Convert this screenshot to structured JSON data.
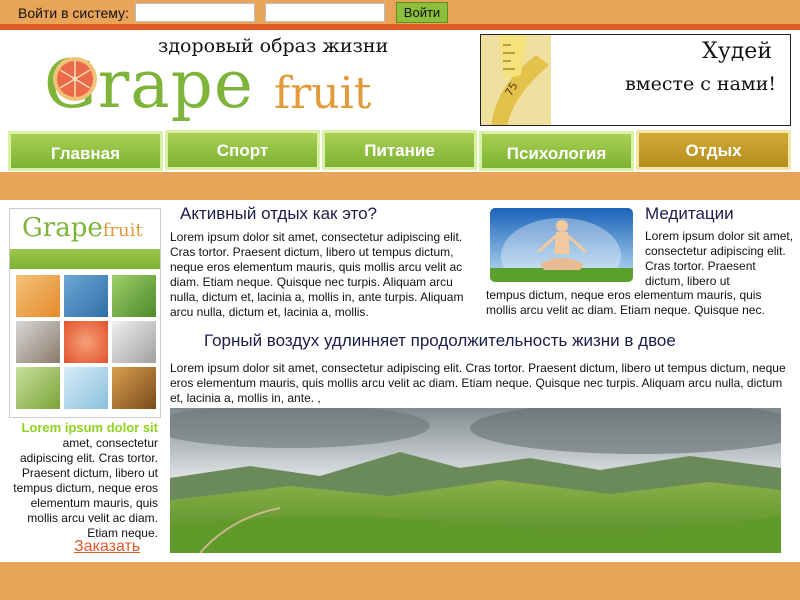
{
  "login": {
    "label": "Войти в систему:",
    "username_value": "",
    "password_value": "",
    "button_label": "Войти"
  },
  "header": {
    "tagline": "здоровый образ жизни",
    "logo_main": "Grape",
    "logo_suffix": "fruit",
    "banner_title": "Худей",
    "banner_subtitle": "вместе с нами!"
  },
  "nav": {
    "items": [
      {
        "label": "Главная"
      },
      {
        "label": "Спорт"
      },
      {
        "label": "Питание"
      },
      {
        "label": "Психология"
      },
      {
        "label": "Отдых",
        "active": true
      }
    ]
  },
  "sidebar": {
    "promo_logo_main": "Grape",
    "promo_logo_suffix": "fruit",
    "highlight": "Lorem ipsum dolor sit",
    "text": "amet, consectetur adipiscing elit. Cras tortor. Praesent dictum, libero ut tempus dictum, neque eros elementum mauris, quis mollis arcu velit ac diam. Etiam neque.",
    "order_link": "Заказать"
  },
  "articles": {
    "active_rest": {
      "title": "Активный отдых как это?",
      "body": "Lorem ipsum dolor sit amet, consectetur adipiscing elit. Cras tortor. Praesent dictum, libero ut tempus dictum, neque eros elementum mauris, quis mollis arcu velit ac diam. Etiam neque. Quisque nec turpis. Aliquam arcu nulla, dictum et, lacinia a, mollis in, ante turpis. Aliquam arcu nulla, dictum et, lacinia a, mollis."
    },
    "meditation": {
      "title": "Медитации",
      "body_top": "Lorem ipsum dolor sit amet, consectetur adipiscing elit. Cras tortor. Praesent dictum, libero ut",
      "body_bottom": "tempus dictum, neque eros elementum mauris, quis mollis arcu velit ac diam. Etiam neque. Quisque nec."
    },
    "mountain_air": {
      "title": "Горный воздух удлинняет продолжительность жизни в двое",
      "body": "Lorem ipsum dolor sit amet, consectetur adipiscing elit. Cras tortor. Praesent dictum, libero ut tempus dictum, neque eros elementum mauris, quis mollis arcu velit ac diam. Etiam neque. Quisque nec turpis. Aliquam arcu nulla, dictum et, lacinia a, mollis in, ante. ,"
    }
  },
  "colors": {
    "accent_orange": "#e8a55a",
    "accent_red": "#e05a28",
    "brand_green": "#7fb43a",
    "nav_active": "#c49e2a"
  }
}
